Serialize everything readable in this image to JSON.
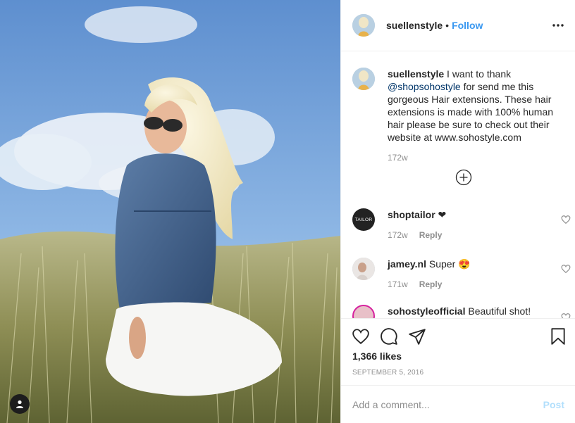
{
  "post": {
    "username": "suellenstyle",
    "separator": "•",
    "follow_label": "Follow",
    "more_icon": "more-horizontal-icon"
  },
  "caption": {
    "username": "suellenstyle",
    "text_before": " I want to thank ",
    "mention": "@shopsohostyle",
    "text_after": " for send me this gorgeous Hair extensions. These hair extensions is made with 100% human hair please be sure to check out their website at www.sohostyle.com",
    "time": "172w",
    "load_more_icon": "plus-circle-icon"
  },
  "comments": [
    {
      "username": "shoptailor",
      "text": " ❤",
      "time": "172w",
      "reply": "Reply",
      "avatar_text": "TAILOR"
    },
    {
      "username": "jamey.nl",
      "text": " Super 😍",
      "time": "171w",
      "reply": "Reply"
    },
    {
      "username": "sohostyleofficial",
      "text": " Beautiful shot!"
    }
  ],
  "actions": {
    "like_icon": "heart-icon",
    "comment_icon": "comment-icon",
    "share_icon": "share-icon",
    "save_icon": "bookmark-icon"
  },
  "likes": "1,366 likes",
  "date": "SEPTEMBER 5, 2016",
  "add_comment": {
    "placeholder": "Add a comment...",
    "post_label": "Post"
  },
  "colors": {
    "accent": "#3897f0",
    "post_disabled": "#b2dffc",
    "muted": "#8e8e8e",
    "mention": "#003569"
  }
}
